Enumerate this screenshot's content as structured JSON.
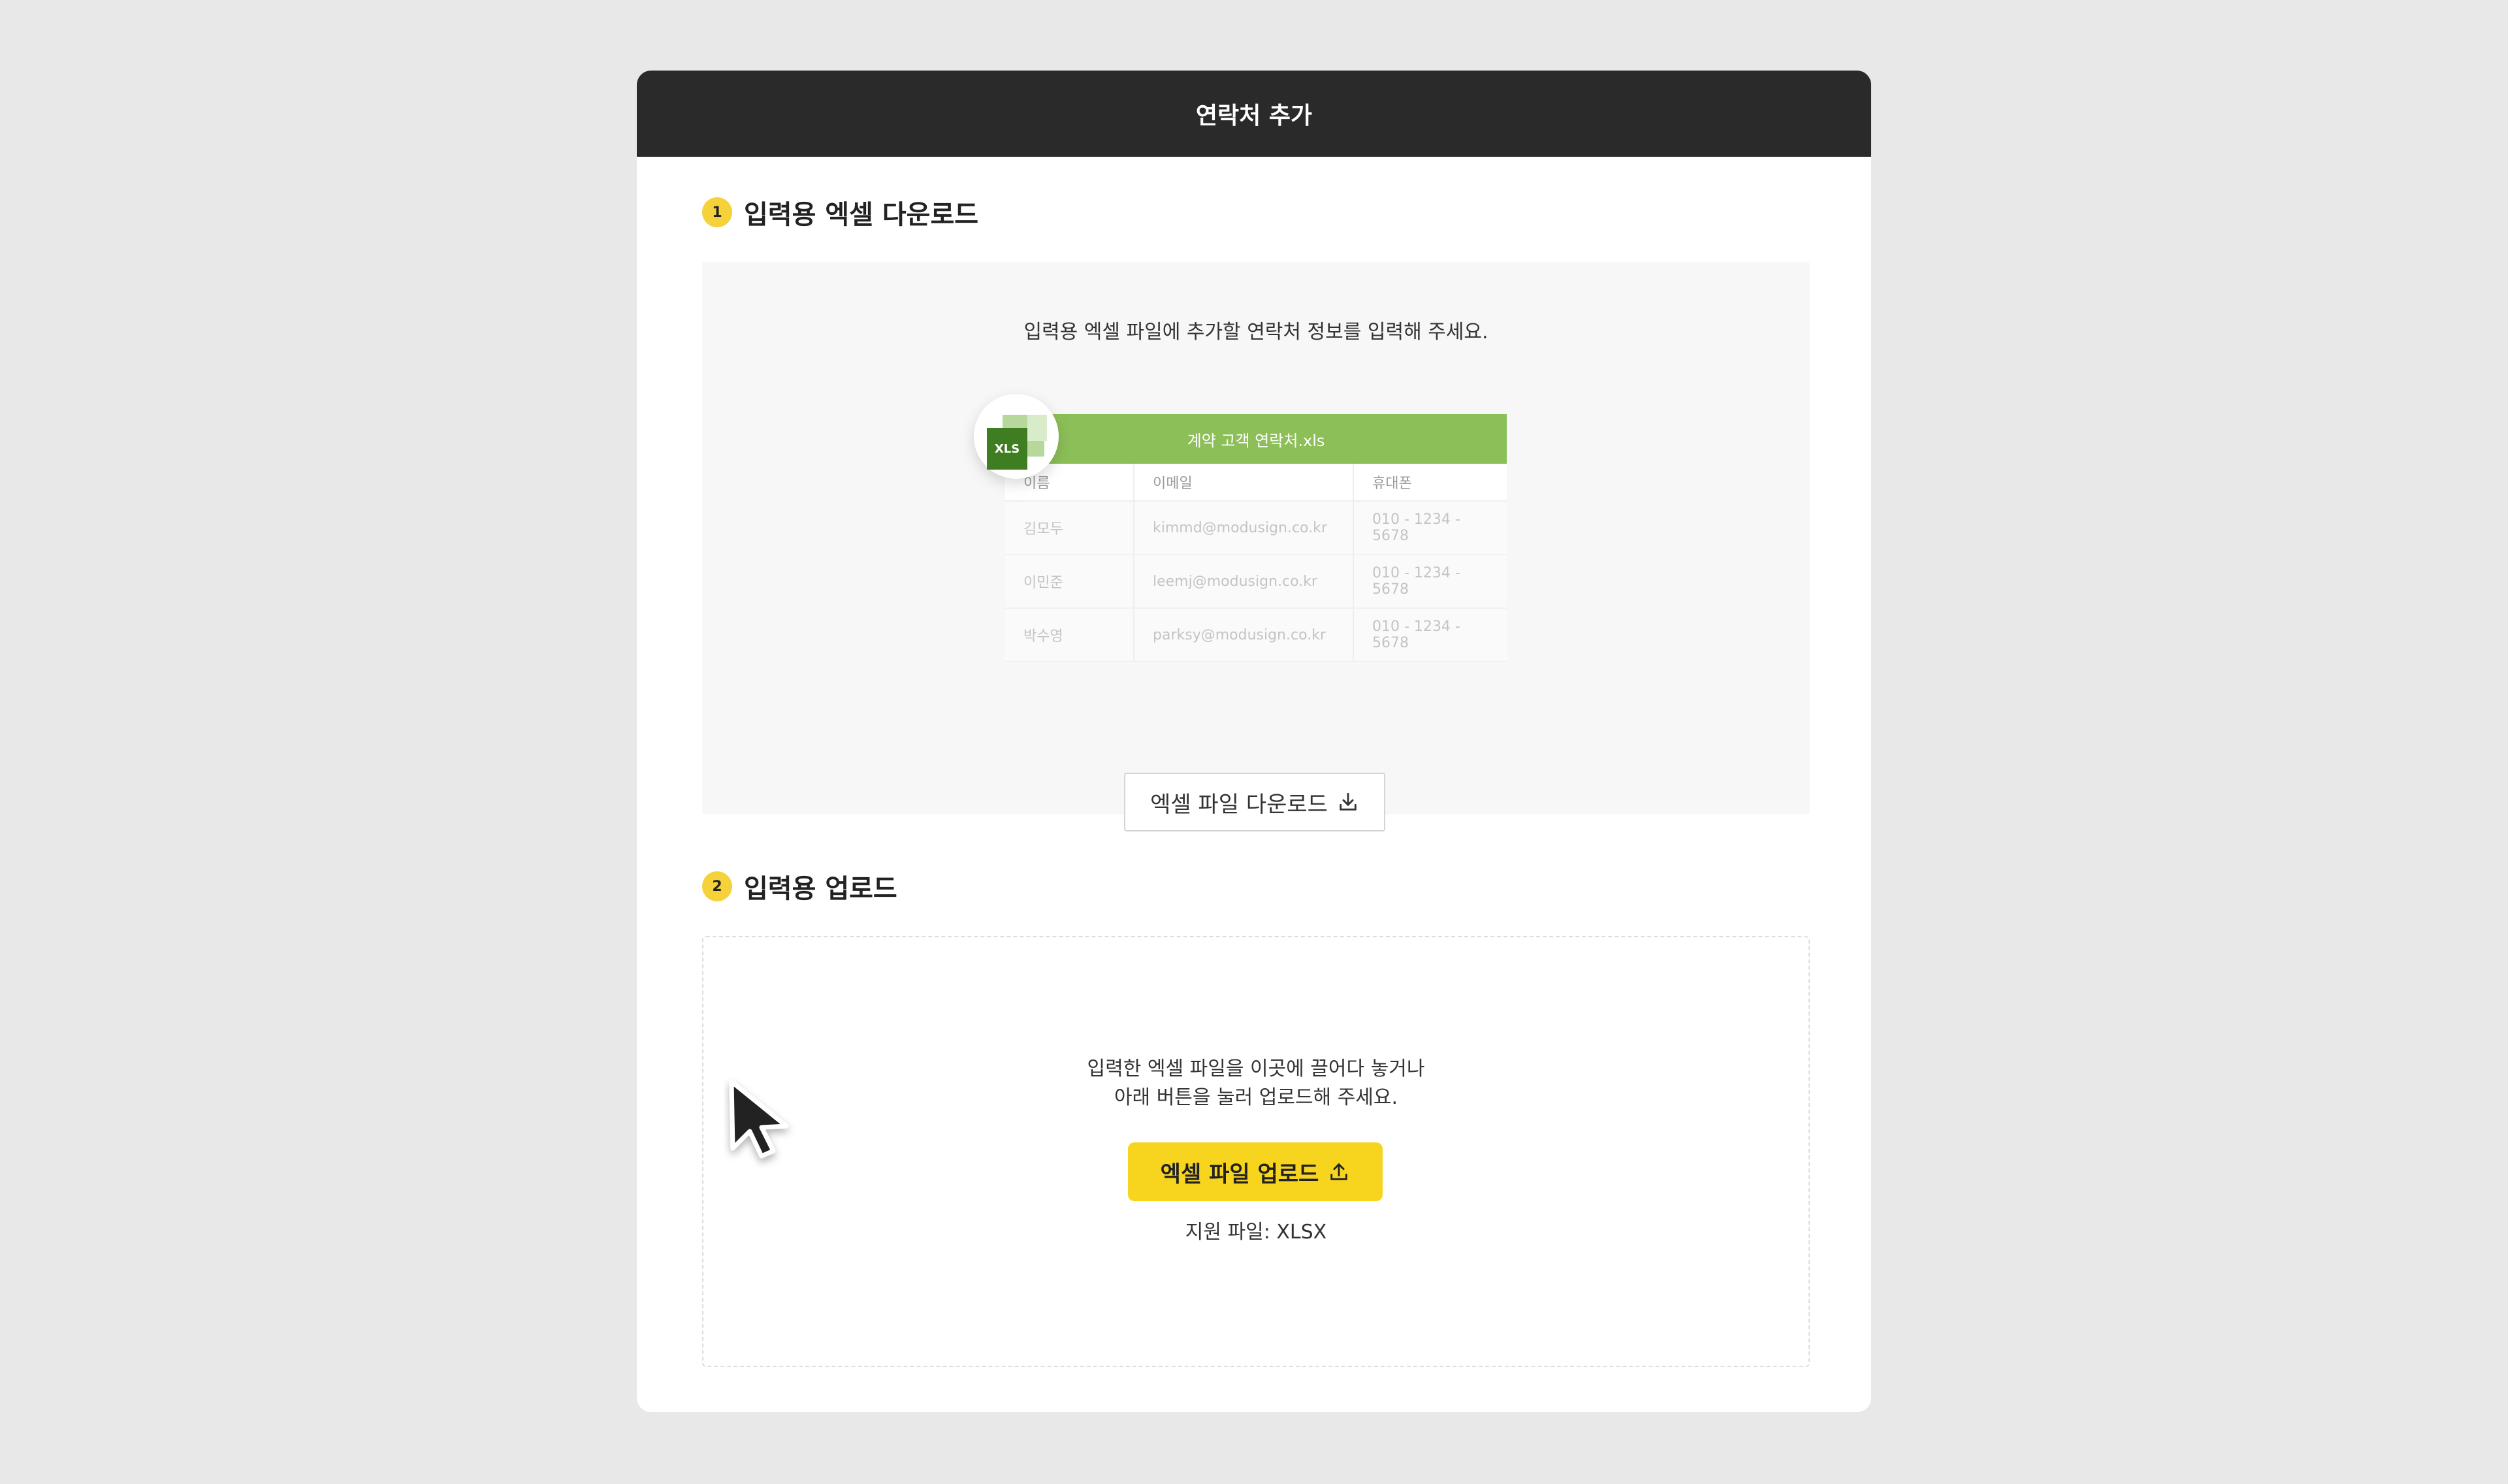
{
  "modal": {
    "title": "연락처 추가"
  },
  "step1": {
    "number": "1",
    "title": "입력용 엑셀 다운로드",
    "description": "입력용 엑셀 파일에 추가할 연락처 정보를 입력해 주세요.",
    "preview": {
      "file_icon": "XLS",
      "file_name": "계약 고객 연락처.xls",
      "columns": [
        "이름",
        "이메일",
        "휴대폰"
      ],
      "rows": [
        [
          "김모두",
          "kimmd@modusign.co.kr",
          "010 - 1234 - 5678"
        ],
        [
          "이민준",
          "leemj@modusign.co.kr",
          "010 - 1234 - 5678"
        ],
        [
          "박수영",
          "parksy@modusign.co.kr",
          "010 - 1234 - 5678"
        ]
      ]
    },
    "download_button": "엑셀 파일 다운로드",
    "download_icon": "download-icon"
  },
  "step2": {
    "number": "2",
    "title": "입력용 업로드",
    "description_line1": "입력한 엑셀 파일을 이곳에 끌어다 놓거나",
    "description_line2": "아래 버튼을 눌러 업로드해 주세요.",
    "upload_button": "엑셀 파일 업로드",
    "upload_icon": "upload-icon",
    "supported": "지원 파일: XLSX"
  },
  "colors": {
    "background": "#e8e8e8",
    "header": "#2a2a2a",
    "accent_yellow": "#f7d51e",
    "excel_green": "#8cbf58"
  }
}
